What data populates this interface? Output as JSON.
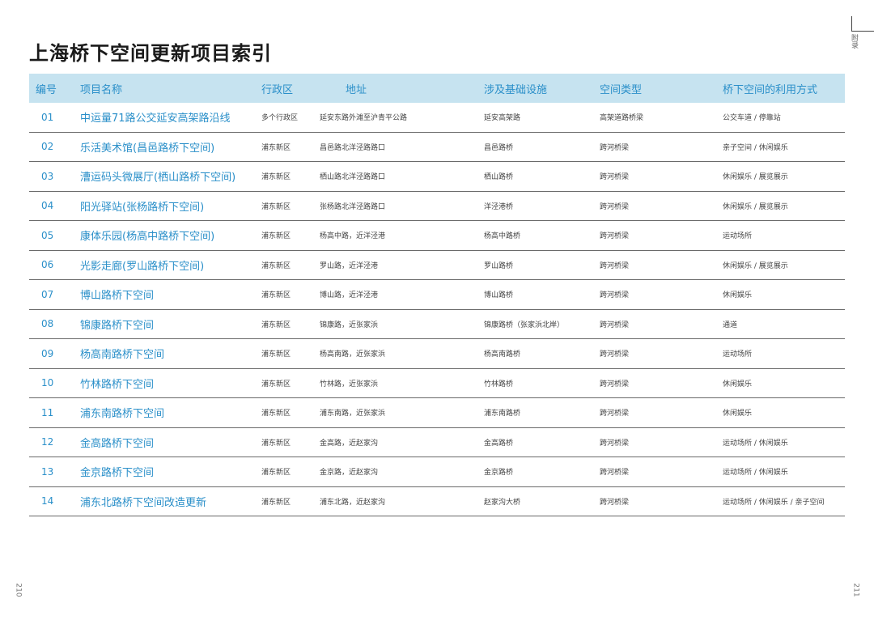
{
  "page": {
    "title": "上海桥下空间更新项目索引",
    "side_label": "附录",
    "page_left": "210",
    "page_right": "211"
  },
  "table": {
    "headers": [
      "编号",
      "项目名称",
      "行政区",
      "地址",
      "涉及基础设施",
      "空间类型",
      "桥下空间的利用方式"
    ],
    "rows": [
      [
        "01",
        "中运量71路公交延安高架路沿线",
        "多个行政区",
        "延安东路外滩至沪青平公路",
        "延安高架路",
        "高架道路桥梁",
        "公交车道 / 停靠站"
      ],
      [
        "02",
        "乐活美术馆(昌邑路桥下空间)",
        "浦东新区",
        "昌邑路北洋泾路路口",
        "昌邑路桥",
        "跨河桥梁",
        "亲子空间 / 休闲娱乐"
      ],
      [
        "03",
        "漕运码头微展厅(栖山路桥下空间)",
        "浦东新区",
        "栖山路北洋泾路路口",
        "栖山路桥",
        "跨河桥梁",
        "休闲娱乐 / 展览展示"
      ],
      [
        "04",
        "阳光驿站(张杨路桥下空间)",
        "浦东新区",
        "张杨路北洋泾路路口",
        "洋泾港桥",
        "跨河桥梁",
        "休闲娱乐 / 展览展示"
      ],
      [
        "05",
        "康体乐园(杨高中路桥下空间)",
        "浦东新区",
        "杨高中路，近洋泾港",
        "杨高中路桥",
        "跨河桥梁",
        "运动场所"
      ],
      [
        "06",
        "光影走廊(罗山路桥下空间)",
        "浦东新区",
        "罗山路，近洋泾港",
        "罗山路桥",
        "跨河桥梁",
        "休闲娱乐 / 展览展示"
      ],
      [
        "07",
        "博山路桥下空间",
        "浦东新区",
        "博山路，近洋泾港",
        "博山路桥",
        "跨河桥梁",
        "休闲娱乐"
      ],
      [
        "08",
        "锦康路桥下空间",
        "浦东新区",
        "锦康路，近张家浜",
        "锦康路桥（张家浜北岸）",
        "跨河桥梁",
        "通道"
      ],
      [
        "09",
        "杨高南路桥下空间",
        "浦东新区",
        "杨高南路，近张家浜",
        "杨高南路桥",
        "跨河桥梁",
        "运动场所"
      ],
      [
        "10",
        "竹林路桥下空间",
        "浦东新区",
        "竹林路，近张家浜",
        "竹林路桥",
        "跨河桥梁",
        "休闲娱乐"
      ],
      [
        "11",
        "浦东南路桥下空间",
        "浦东新区",
        "浦东南路，近张家浜",
        "浦东南路桥",
        "跨河桥梁",
        "休闲娱乐"
      ],
      [
        "12",
        "金高路桥下空间",
        "浦东新区",
        "金高路，近赵家沟",
        "金高路桥",
        "跨河桥梁",
        "运动场所 / 休闲娱乐"
      ],
      [
        "13",
        "金京路桥下空间",
        "浦东新区",
        "金京路，近赵家沟",
        "金京路桥",
        "跨河桥梁",
        "运动场所 / 休闲娱乐"
      ],
      [
        "14",
        "浦东北路桥下空间改造更新",
        "浦东新区",
        "浦东北路，近赵家沟",
        "赵家沟大桥",
        "跨河桥梁",
        "运动场所 / 休闲娱乐 / 亲子空间"
      ]
    ]
  }
}
